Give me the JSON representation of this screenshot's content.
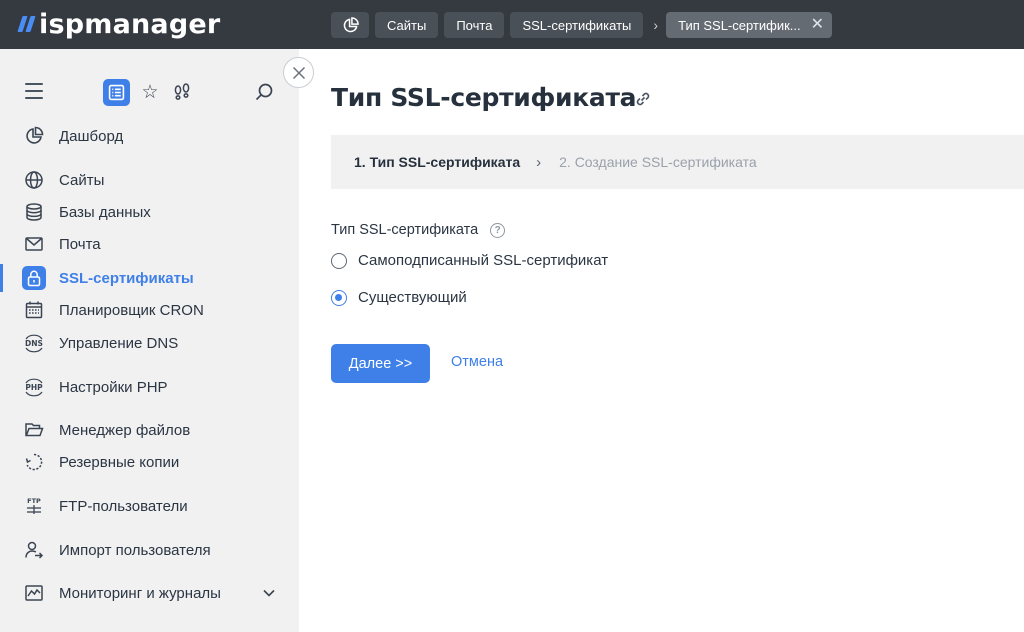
{
  "app": {
    "logo_text": "ispmanager"
  },
  "breadcrumbs": {
    "home_icon": "dashboard-pie-icon",
    "items": [
      {
        "label": "Сайты"
      },
      {
        "label": "Почта"
      },
      {
        "label": "SSL-сертификаты"
      }
    ],
    "separator": "›",
    "active": {
      "label": "Тип SSL-сертифик...",
      "close": "✕"
    }
  },
  "sidebar": {
    "tools": {
      "menu_icon": "hamburger-menu-icon",
      "list_icon": "list-icon",
      "star": "☆",
      "feet_icon": "footprints-icon",
      "search_icon": "search-icon",
      "collapse": "✕"
    },
    "items": [
      {
        "label": "Дашборд",
        "icon": "pie-chart-icon"
      },
      {
        "label": "Сайты",
        "icon": "globe-icon"
      },
      {
        "label": "Базы данных",
        "icon": "database-icon"
      },
      {
        "label": "Почта",
        "icon": "envelope-icon"
      },
      {
        "label": "SSL-сертификаты",
        "icon": "lock-icon",
        "active": true
      },
      {
        "label": "Планировщик CRON",
        "icon": "calendar-icon"
      },
      {
        "label": "Управление DNS",
        "icon": "dns-icon"
      },
      {
        "label": "Настройки PHP",
        "icon": "php-icon"
      },
      {
        "label": "Менеджер файлов",
        "icon": "folder-icon"
      },
      {
        "label": "Резервные копии",
        "icon": "backup-icon"
      },
      {
        "label": "FTP-пользователи",
        "icon": "ftp-icon"
      },
      {
        "label": "Импорт пользователя",
        "icon": "user-import-icon"
      },
      {
        "label": "Мониторинг и журналы",
        "icon": "monitoring-icon"
      }
    ]
  },
  "main": {
    "title": "Тип SSL-сертификата",
    "steps": {
      "current": "1. Тип SSL-сертификата",
      "separator": "›",
      "next": "2. Создание SSL-сертификата"
    },
    "form": {
      "label": "Тип SSL-сертификата",
      "help": "?",
      "options": [
        {
          "label": "Самоподписанный SSL-сертификат",
          "checked": false
        },
        {
          "label": "Существующий",
          "checked": true
        }
      ]
    },
    "buttons": {
      "next": "Далее >>",
      "cancel": "Отмена"
    }
  },
  "colors": {
    "accent": "#3f80e8",
    "topbar": "#343a40",
    "sidebar": "#f1f1f2"
  }
}
